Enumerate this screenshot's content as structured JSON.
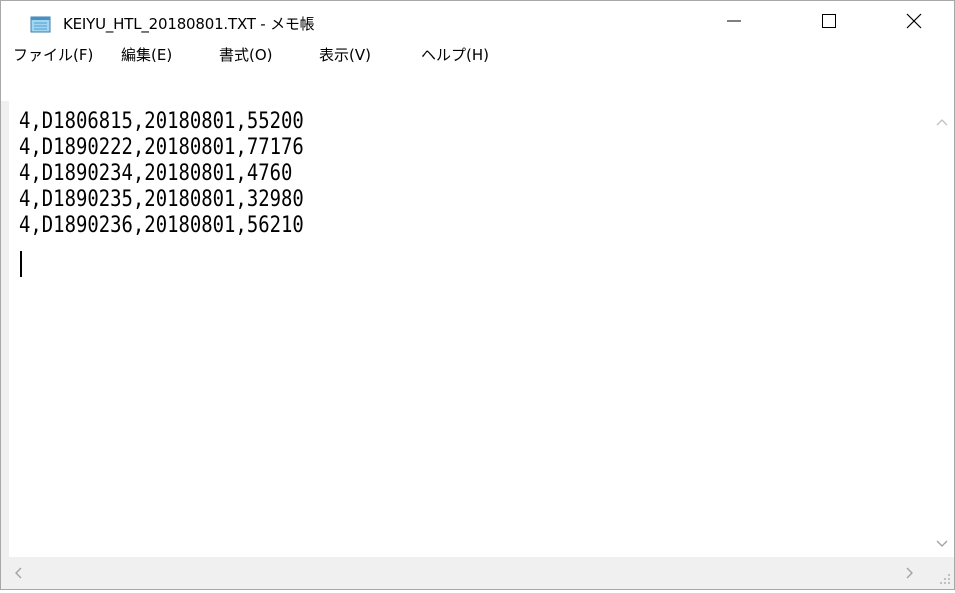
{
  "window": {
    "title": "KEIYU_HTL_20180801.TXT - メモ帳",
    "app_icon": "notepad-icon"
  },
  "menu": {
    "items": [
      {
        "label": "ファイル(F)"
      },
      {
        "label": "編集(E)"
      },
      {
        "label": "書式(O)"
      },
      {
        "label": "表示(V)"
      },
      {
        "label": "ヘルプ(H)"
      }
    ]
  },
  "editor": {
    "lines": [
      "4,D1806815,20180801,55200",
      "4,D1890222,20180801,77176",
      "4,D1890234,20180801,4760",
      "4,D1890235,20180801,32980",
      "4,D1890236,20180801,56210"
    ]
  },
  "colors": {
    "titlebar_bg": "#ffffff",
    "scrollbar_bg": "#f0f0f0",
    "text": "#000000"
  }
}
